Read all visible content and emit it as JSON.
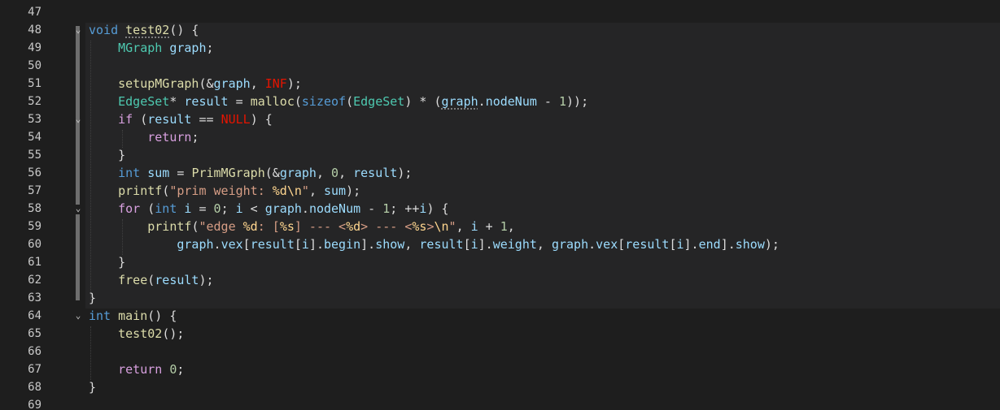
{
  "editor": {
    "language": "C",
    "theme": "dark",
    "colors": {
      "background": "#1e1e1e",
      "keyword": "#569cd6",
      "control": "#d8a0df",
      "type": "#4ec9b0",
      "function": "#dcdcaa",
      "variable": "#9cdcfe",
      "number": "#b5cea8",
      "string": "#d69d85",
      "macro": "#e51400"
    },
    "lines": [
      {
        "num": "47",
        "fold": "",
        "tokens": []
      },
      {
        "num": "48",
        "fold": "⌄",
        "tokens": [
          [
            "kw",
            "void"
          ],
          [
            "pl",
            " "
          ],
          [
            "fnsq",
            "test02"
          ],
          [
            "pl",
            "() {"
          ]
        ]
      },
      {
        "num": "49",
        "fold": "",
        "tokens": [
          [
            "pl",
            "    "
          ],
          [
            "ty",
            "MGraph"
          ],
          [
            "pl",
            " "
          ],
          [
            "var",
            "graph"
          ],
          [
            "pl",
            ";"
          ]
        ]
      },
      {
        "num": "50",
        "fold": "",
        "tokens": []
      },
      {
        "num": "51",
        "fold": "",
        "tokens": [
          [
            "pl",
            "    "
          ],
          [
            "fn",
            "setupMGraph"
          ],
          [
            "pl",
            "(&"
          ],
          [
            "var",
            "graph"
          ],
          [
            "pl",
            ", "
          ],
          [
            "mac",
            "INF"
          ],
          [
            "pl",
            ");"
          ]
        ]
      },
      {
        "num": "52",
        "fold": "",
        "tokens": [
          [
            "pl",
            "    "
          ],
          [
            "ty",
            "EdgeSet"
          ],
          [
            "pl",
            "* "
          ],
          [
            "var",
            "result"
          ],
          [
            "pl",
            " = "
          ],
          [
            "fn",
            "malloc"
          ],
          [
            "pl",
            "("
          ],
          [
            "kw",
            "sizeof"
          ],
          [
            "pl",
            "("
          ],
          [
            "ty",
            "EdgeSet"
          ],
          [
            "pl",
            ") * ("
          ],
          [
            "varsq",
            "graph"
          ],
          [
            "pl",
            "."
          ],
          [
            "var",
            "nodeNum"
          ],
          [
            "pl",
            " - "
          ],
          [
            "num",
            "1"
          ],
          [
            "pl",
            "));"
          ]
        ]
      },
      {
        "num": "53",
        "fold": "⌄",
        "tokens": [
          [
            "pl",
            "    "
          ],
          [
            "ctl",
            "if"
          ],
          [
            "pl",
            " ("
          ],
          [
            "var",
            "result"
          ],
          [
            "pl",
            " == "
          ],
          [
            "mac",
            "NULL"
          ],
          [
            "pl",
            ") {"
          ]
        ]
      },
      {
        "num": "54",
        "fold": "",
        "tokens": [
          [
            "pl",
            "        "
          ],
          [
            "ctl",
            "return"
          ],
          [
            "pl",
            ";"
          ]
        ]
      },
      {
        "num": "55",
        "fold": "",
        "tokens": [
          [
            "pl",
            "    }"
          ]
        ]
      },
      {
        "num": "56",
        "fold": "",
        "tokens": [
          [
            "pl",
            "    "
          ],
          [
            "kw",
            "int"
          ],
          [
            "pl",
            " "
          ],
          [
            "var",
            "sum"
          ],
          [
            "pl",
            " = "
          ],
          [
            "fn",
            "PrimMGraph"
          ],
          [
            "pl",
            "(&"
          ],
          [
            "var",
            "graph"
          ],
          [
            "pl",
            ", "
          ],
          [
            "num",
            "0"
          ],
          [
            "pl",
            ", "
          ],
          [
            "var",
            "result"
          ],
          [
            "pl",
            ");"
          ]
        ]
      },
      {
        "num": "57",
        "fold": "",
        "tokens": [
          [
            "pl",
            "    "
          ],
          [
            "fn",
            "printf"
          ],
          [
            "pl",
            "("
          ],
          [
            "str",
            "\"prim weight: "
          ],
          [
            "esc",
            "%d\\n"
          ],
          [
            "str",
            "\""
          ],
          [
            "pl",
            ", "
          ],
          [
            "var",
            "sum"
          ],
          [
            "pl",
            ");"
          ]
        ]
      },
      {
        "num": "58",
        "fold": "⌄",
        "tokens": [
          [
            "pl",
            "    "
          ],
          [
            "ctl",
            "for"
          ],
          [
            "pl",
            " ("
          ],
          [
            "kw",
            "int"
          ],
          [
            "pl",
            " "
          ],
          [
            "var",
            "i"
          ],
          [
            "pl",
            " = "
          ],
          [
            "num",
            "0"
          ],
          [
            "pl",
            "; "
          ],
          [
            "var",
            "i"
          ],
          [
            "pl",
            " < "
          ],
          [
            "var",
            "graph"
          ],
          [
            "pl",
            "."
          ],
          [
            "var",
            "nodeNum"
          ],
          [
            "pl",
            " - "
          ],
          [
            "num",
            "1"
          ],
          [
            "pl",
            "; ++"
          ],
          [
            "var",
            "i"
          ],
          [
            "pl",
            ") {"
          ]
        ]
      },
      {
        "num": "59",
        "fold": "",
        "tokens": [
          [
            "pl",
            "        "
          ],
          [
            "fn",
            "printf"
          ],
          [
            "pl",
            "("
          ],
          [
            "str",
            "\"edge "
          ],
          [
            "esc",
            "%d"
          ],
          [
            "str",
            ": ["
          ],
          [
            "esc",
            "%s"
          ],
          [
            "str",
            "] --- <"
          ],
          [
            "esc",
            "%d"
          ],
          [
            "str",
            "> --- <"
          ],
          [
            "esc",
            "%s"
          ],
          [
            "str",
            ">"
          ],
          [
            "esc",
            "\\n"
          ],
          [
            "str",
            "\""
          ],
          [
            "pl",
            ", "
          ],
          [
            "var",
            "i"
          ],
          [
            "pl",
            " + "
          ],
          [
            "num",
            "1"
          ],
          [
            "pl",
            ","
          ]
        ]
      },
      {
        "num": "60",
        "fold": "",
        "tokens": [
          [
            "pl",
            "            "
          ],
          [
            "var",
            "graph"
          ],
          [
            "pl",
            "."
          ],
          [
            "var",
            "vex"
          ],
          [
            "pl",
            "["
          ],
          [
            "var",
            "result"
          ],
          [
            "pl",
            "["
          ],
          [
            "var",
            "i"
          ],
          [
            "pl",
            "]."
          ],
          [
            "var",
            "begin"
          ],
          [
            "pl",
            "]."
          ],
          [
            "var",
            "show"
          ],
          [
            "pl",
            ", "
          ],
          [
            "var",
            "result"
          ],
          [
            "pl",
            "["
          ],
          [
            "var",
            "i"
          ],
          [
            "pl",
            "]."
          ],
          [
            "var",
            "weight"
          ],
          [
            "pl",
            ", "
          ],
          [
            "var",
            "graph"
          ],
          [
            "pl",
            "."
          ],
          [
            "var",
            "vex"
          ],
          [
            "pl",
            "["
          ],
          [
            "var",
            "result"
          ],
          [
            "pl",
            "["
          ],
          [
            "var",
            "i"
          ],
          [
            "pl",
            "]."
          ],
          [
            "var",
            "end"
          ],
          [
            "pl",
            "]."
          ],
          [
            "var",
            "show"
          ],
          [
            "pl",
            ");"
          ]
        ]
      },
      {
        "num": "61",
        "fold": "",
        "tokens": [
          [
            "pl",
            "    }"
          ]
        ]
      },
      {
        "num": "62",
        "fold": "",
        "tokens": [
          [
            "pl",
            "    "
          ],
          [
            "fn",
            "free"
          ],
          [
            "pl",
            "("
          ],
          [
            "var",
            "result"
          ],
          [
            "pl",
            ");"
          ]
        ]
      },
      {
        "num": "63",
        "fold": "",
        "tokens": [
          [
            "pl",
            "}"
          ]
        ]
      },
      {
        "num": "64",
        "fold": "⌄",
        "tokens": [
          [
            "kw",
            "int"
          ],
          [
            "pl",
            " "
          ],
          [
            "fn",
            "main"
          ],
          [
            "pl",
            "() {"
          ]
        ]
      },
      {
        "num": "65",
        "fold": "",
        "tokens": [
          [
            "pl",
            "    "
          ],
          [
            "fn",
            "test02"
          ],
          [
            "pl",
            "();"
          ]
        ]
      },
      {
        "num": "66",
        "fold": "",
        "tokens": []
      },
      {
        "num": "67",
        "fold": "",
        "tokens": [
          [
            "pl",
            "    "
          ],
          [
            "ctl",
            "return"
          ],
          [
            "pl",
            " "
          ],
          [
            "num",
            "0"
          ],
          [
            "pl",
            ";"
          ]
        ]
      },
      {
        "num": "68",
        "fold": "",
        "tokens": [
          [
            "pl",
            "}"
          ]
        ]
      },
      {
        "num": "69",
        "fold": "",
        "tokens": []
      }
    ]
  }
}
